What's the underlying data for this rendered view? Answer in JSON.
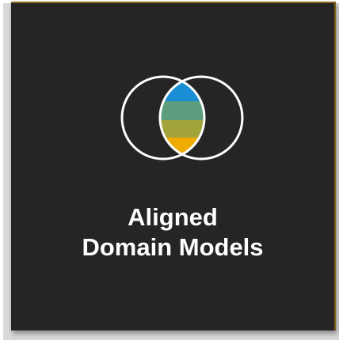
{
  "tile": {
    "title_line1": "Aligned",
    "title_line2": "Domain Models",
    "icon": "venn-diagram-icon",
    "colors": {
      "background": "#252525",
      "text": "#ffffff",
      "ring": "#ffffff",
      "band_blue": "#1b8fd6",
      "band_teal": "#5e9c7e",
      "band_olive": "#a2a43b",
      "band_gold": "#f0ab00",
      "border_accent": "#8a6a1e"
    }
  }
}
